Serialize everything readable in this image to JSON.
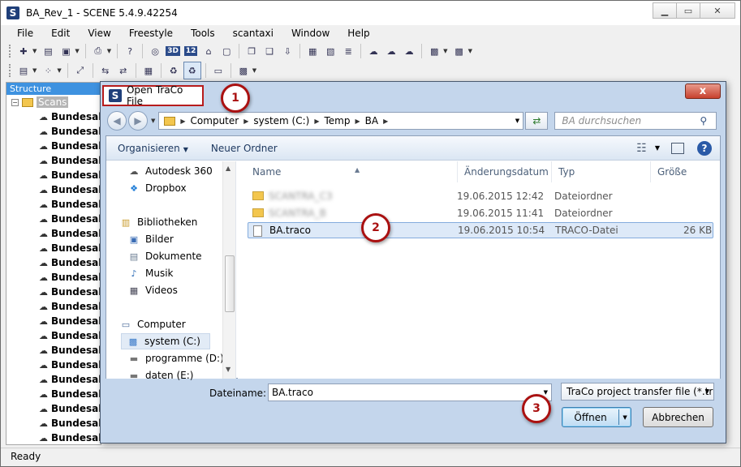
{
  "app": {
    "title": "BA_Rev_1 - SCENE 5.4.9.42254",
    "logo_letter": "S",
    "menu": [
      "File",
      "Edit",
      "View",
      "Freestyle",
      "Tools",
      "scantaxi",
      "Window",
      "Help"
    ],
    "toolbar_labels": {
      "three_d": "3D",
      "twelve": "12"
    },
    "status": "Ready"
  },
  "structure": {
    "header": "Structure",
    "root_label": "Scans",
    "toggle": "−",
    "item_label": "Bundesall",
    "items": [
      "Bundesall",
      "Bundesall",
      "Bundesall",
      "Bundesall",
      "Bundesall",
      "Bundesall",
      "Bundesall",
      "Bundesall",
      "Bundesall",
      "Bundesall",
      "Bundesall",
      "Bundesall",
      "Bundesall",
      "Bundesall",
      "Bundesall",
      "Bundesall",
      "Bundesall",
      "Bundesall",
      "Bundesall",
      "Bundesall",
      "Bundesall",
      "Bundesall",
      "Bundesall",
      "Bundesall"
    ]
  },
  "dialog": {
    "title": "Open TraCo File",
    "close_glyph": "x",
    "breadcrumbs": [
      "Computer",
      "system (C:)",
      "Temp",
      "BA"
    ],
    "search_placeholder": "BA durchsuchen",
    "commands": {
      "organize": "Organisieren",
      "new_folder": "Neuer Ordner"
    },
    "nav_items": [
      {
        "label": "Autodesk 360",
        "icon": "cloud-icon"
      },
      {
        "label": "Dropbox",
        "icon": "dropbox-icon"
      },
      {
        "label": "Bibliotheken",
        "icon": "libraries-icon"
      },
      {
        "label": "Bilder",
        "icon": "pictures-icon"
      },
      {
        "label": "Dokumente",
        "icon": "documents-icon"
      },
      {
        "label": "Musik",
        "icon": "music-icon"
      },
      {
        "label": "Videos",
        "icon": "videos-icon"
      },
      {
        "label": "Computer",
        "icon": "computer-icon"
      },
      {
        "label": "system (C:)",
        "icon": "drive-windows-icon"
      },
      {
        "label": "programme (D:)",
        "icon": "drive-icon"
      },
      {
        "label": "daten (E:)",
        "icon": "drive-icon"
      }
    ],
    "columns": [
      "Name",
      "Änderungsdatum",
      "Typ",
      "Größe"
    ],
    "files": [
      {
        "name": "SCANTRA_C3",
        "date": "19.06.2015 12:42",
        "type": "Dateiordner",
        "size": "",
        "blurred": true,
        "kind": "folder"
      },
      {
        "name": "SCANTRA_B",
        "date": "19.06.2015 11:41",
        "type": "Dateiordner",
        "size": "",
        "blurred": true,
        "kind": "folder"
      },
      {
        "name": "BA.traco",
        "date": "19.06.2015 10:54",
        "type": "TRACO-Datei",
        "size": "26 KB",
        "blurred": false,
        "kind": "file"
      }
    ],
    "filename_label": "Dateiname:",
    "filename_value": "BA.traco",
    "filter": "TraCo project transfer file (*.tra",
    "open_label": "Öffnen",
    "cancel_label": "Abbrechen"
  },
  "callouts": [
    "1",
    "2",
    "3"
  ],
  "colors": {
    "callout": "#aa1111",
    "structure_header": "#3e92e0",
    "selection": "#dde9f8"
  }
}
